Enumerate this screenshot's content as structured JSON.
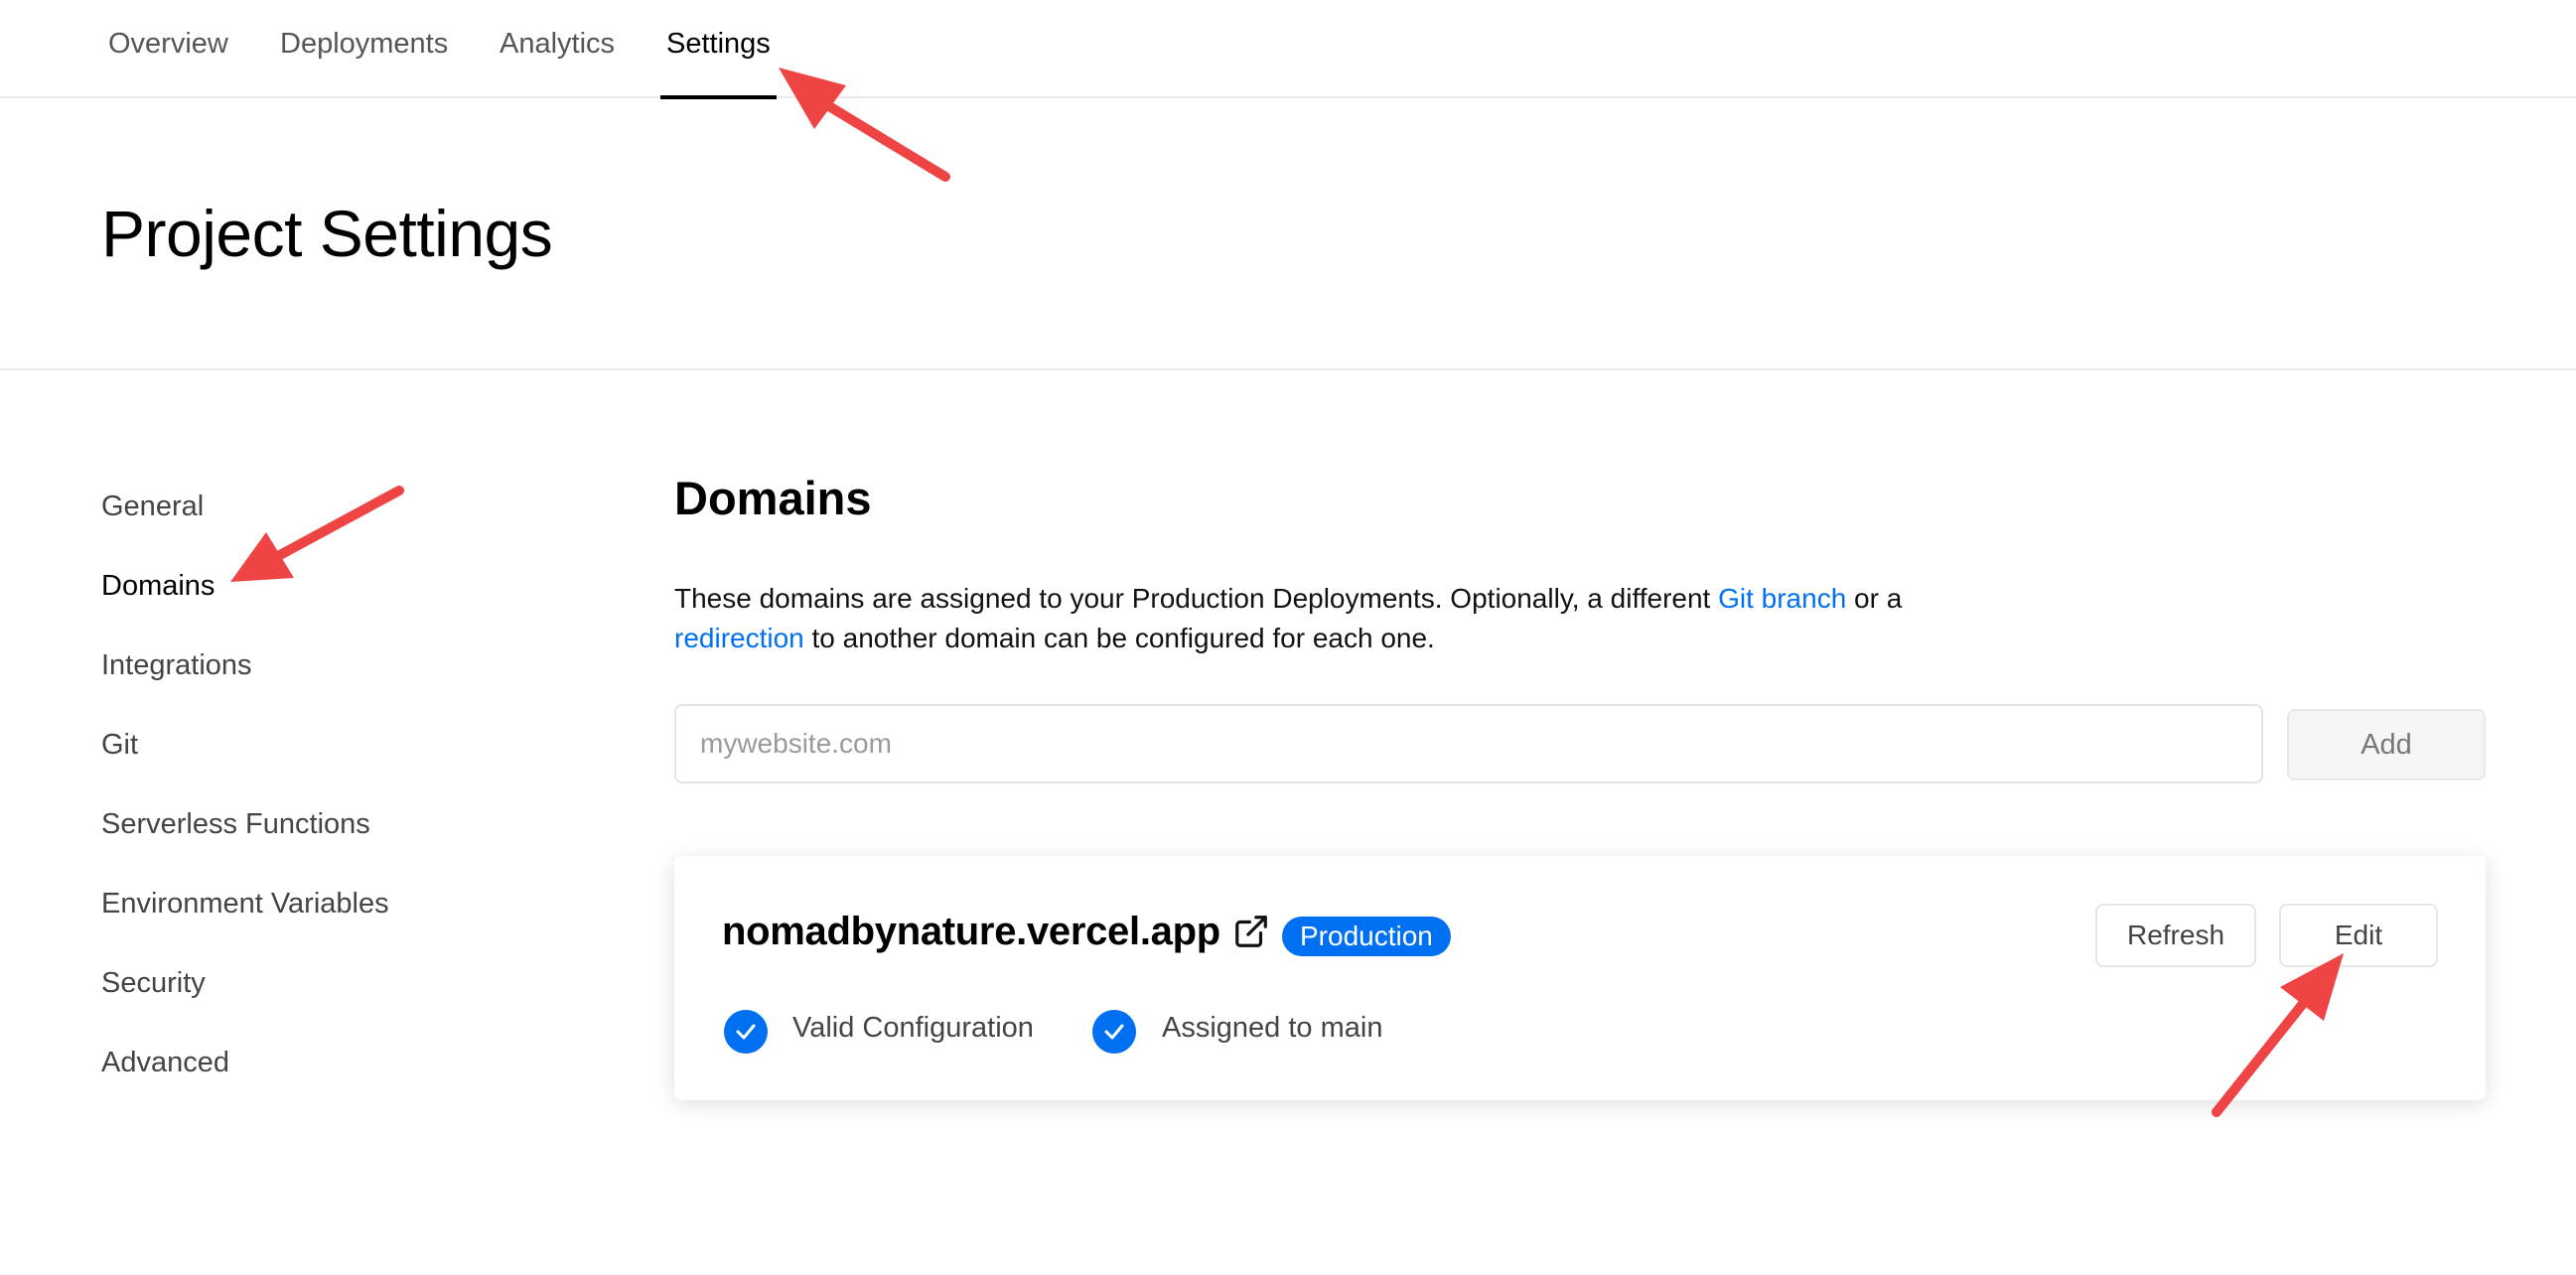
{
  "tabs": [
    {
      "label": "Overview"
    },
    {
      "label": "Deployments"
    },
    {
      "label": "Analytics"
    },
    {
      "label": "Settings"
    }
  ],
  "page_title": "Project Settings",
  "sidebar": {
    "items": [
      {
        "label": "General"
      },
      {
        "label": "Domains"
      },
      {
        "label": "Integrations"
      },
      {
        "label": "Git"
      },
      {
        "label": "Serverless Functions"
      },
      {
        "label": "Environment Variables"
      },
      {
        "label": "Security"
      },
      {
        "label": "Advanced"
      }
    ]
  },
  "domains": {
    "title": "Domains",
    "description_part1": "These domains are assigned to your Production Deployments. Optionally, a different ",
    "git_branch_link": "Git branch",
    "description_part2": " or a ",
    "redirection_link": "redirection",
    "description_part3": " to another domain can be configured for each one.",
    "input_placeholder": "mywebsite.com",
    "input_value": "",
    "add_label": "Add"
  },
  "domain_card": {
    "domain": "nomadbynature.vercel.app",
    "badge": "Production",
    "refresh_label": "Refresh",
    "edit_label": "Edit",
    "status_valid": "Valid Configuration",
    "status_assigned": "Assigned to main"
  },
  "colors": {
    "accent": "#0070f3",
    "annotation_arrow": "#ee4444"
  }
}
